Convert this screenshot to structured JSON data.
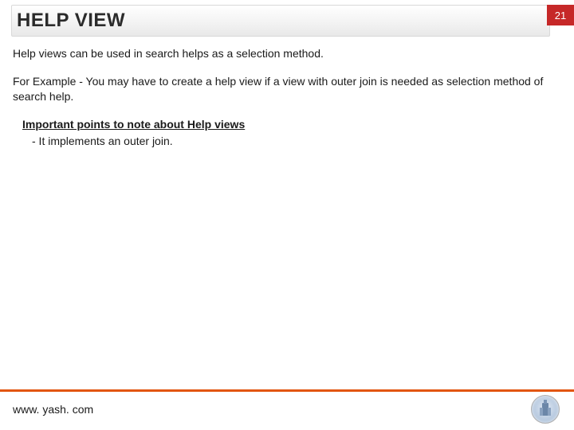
{
  "page_number": "21",
  "title": "HELP VIEW",
  "para1": "Help views can be used in search helps as a selection method.",
  "para2": "For Example - You may have to create a help view if a view with outer join is needed as selection method of search help.",
  "subhead": "Important points to note about Help views",
  "bullet1": "- It implements an outer join.",
  "footer_url": "www. yash. com"
}
